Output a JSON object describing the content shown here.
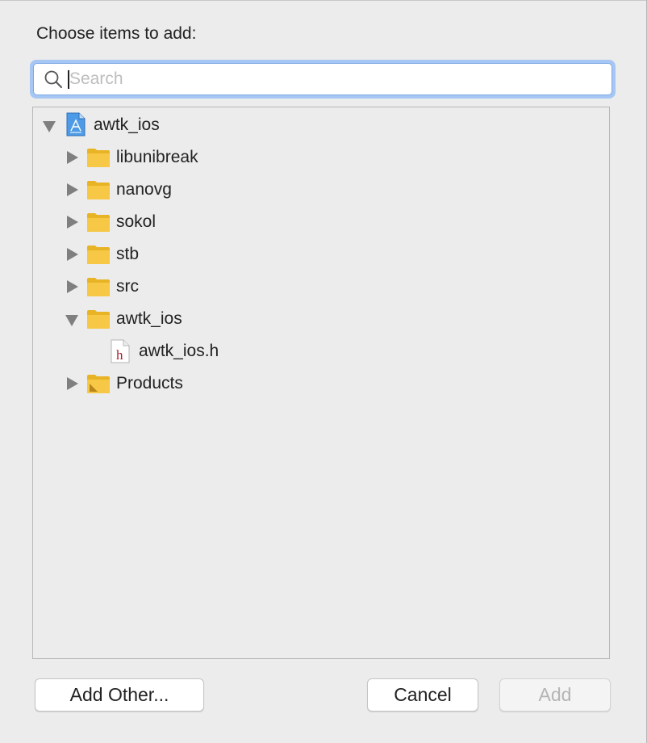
{
  "dialog": {
    "prompt": "Choose items to add:"
  },
  "search": {
    "placeholder": "Search",
    "value": ""
  },
  "tree": {
    "root": {
      "label": "awtk_ios",
      "icon": "xcode-project-icon",
      "expanded": true
    },
    "items": [
      {
        "label": "libunibreak",
        "icon": "folder-icon",
        "expanded": false
      },
      {
        "label": "nanovg",
        "icon": "folder-icon",
        "expanded": false
      },
      {
        "label": "sokol",
        "icon": "folder-icon",
        "expanded": false
      },
      {
        "label": "stb",
        "icon": "folder-icon",
        "expanded": false
      },
      {
        "label": "src",
        "icon": "folder-icon",
        "expanded": false
      },
      {
        "label": "awtk_ios",
        "icon": "folder-icon",
        "expanded": true
      },
      {
        "label": "awtk_ios.h",
        "icon": "header-file-icon"
      },
      {
        "label": "Products",
        "icon": "products-folder-icon",
        "expanded": false
      }
    ]
  },
  "buttons": {
    "add_other": "Add Other...",
    "cancel": "Cancel",
    "add": "Add"
  },
  "colors": {
    "folder": "#f6c845",
    "focus_ring": "#a6c6f4",
    "disclosure": "#7f7f7f"
  }
}
